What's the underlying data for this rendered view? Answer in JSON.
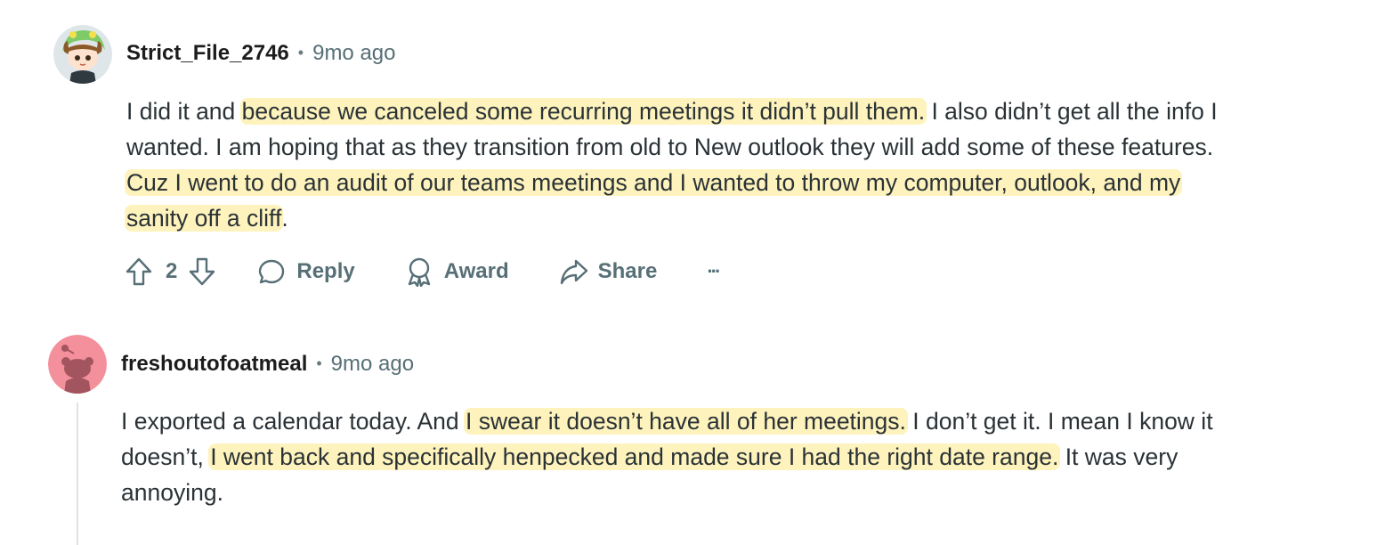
{
  "comments": [
    {
      "username": "Strict_File_2746",
      "separator": "•",
      "time": "9mo ago",
      "lines": [
        [
          {
            "t": "I did it and ",
            "h": false
          },
          {
            "t": "because we canceled some recurring meetings it didn’t pull them.",
            "h": true
          },
          {
            "t": " I also didn’t get all the info I",
            "h": false
          }
        ],
        [
          {
            "t": "wanted. I am hoping that as they transition from old to New outlook they will add some of these features.",
            "h": false
          }
        ],
        [
          {
            "t": "Cuz I went to do an audit of our teams meetings and I wanted to throw my computer, outlook, and my",
            "h": true
          }
        ],
        [
          {
            "t": "sanity off a cliff",
            "h": true
          },
          {
            "t": ".",
            "h": false
          }
        ]
      ],
      "actions": {
        "vote_count": "2",
        "reply_label": "Reply",
        "award_label": "Award",
        "share_label": "Share",
        "more_label": "···"
      }
    },
    {
      "username": "freshoutofoatmeal",
      "separator": "•",
      "time": "9mo ago",
      "lines": [
        [
          {
            "t": "I exported a calendar today. And ",
            "h": false
          },
          {
            "t": "I swear it doesn’t have all of her meetings.",
            "h": true
          },
          {
            "t": " I don’t get it. I mean I know it",
            "h": false
          }
        ],
        [
          {
            "t": "doesn’t, ",
            "h": false
          },
          {
            "t": "I went back and specifically henpecked and made sure I had the right date range.",
            "h": true
          },
          {
            "t": " It was very",
            "h": false
          }
        ],
        [
          {
            "t": "annoying.",
            "h": false
          }
        ]
      ]
    }
  ],
  "colors": {
    "highlight": "#fef3bd",
    "meta_gray": "#576f76",
    "avatar2_bg": "#f4909b"
  }
}
